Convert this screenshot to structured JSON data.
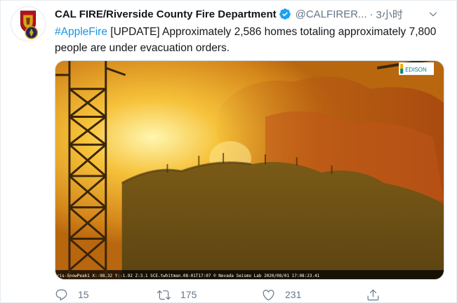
{
  "tweet": {
    "author_name": "CAL FIRE/Riverside County Fire Department",
    "author_handle": "@CALFIRER...",
    "separator": "·",
    "timestamp": "3小时",
    "hashtag": "#AppleFire",
    "body": " [UPDATE] Approximately 2,586 homes totaling approximately 7,800 people are under evacuation orders."
  },
  "media": {
    "watermark": "EDISON",
    "overlay_caption": "ris-SnowPeak1 X:-98.32 Y:-1.92 Z:3.1 SCE.twhitman.08-01T17:07 © Nevada Seismo Lab 2020/08/01 17:08:23.41"
  },
  "actions": {
    "replies": "15",
    "retweets": "175",
    "likes": "231"
  },
  "icons": {
    "avatar": "cal-fire-logo-icon",
    "verified": "verified-badge-icon",
    "menu": "chevron-down-icon",
    "reply": "reply-icon",
    "retweet": "retweet-icon",
    "like": "heart-icon",
    "share": "share-icon"
  },
  "colors": {
    "link_blue": "#1b95e0",
    "verified_blue": "#1da1f2",
    "muted_gray": "#657786"
  }
}
